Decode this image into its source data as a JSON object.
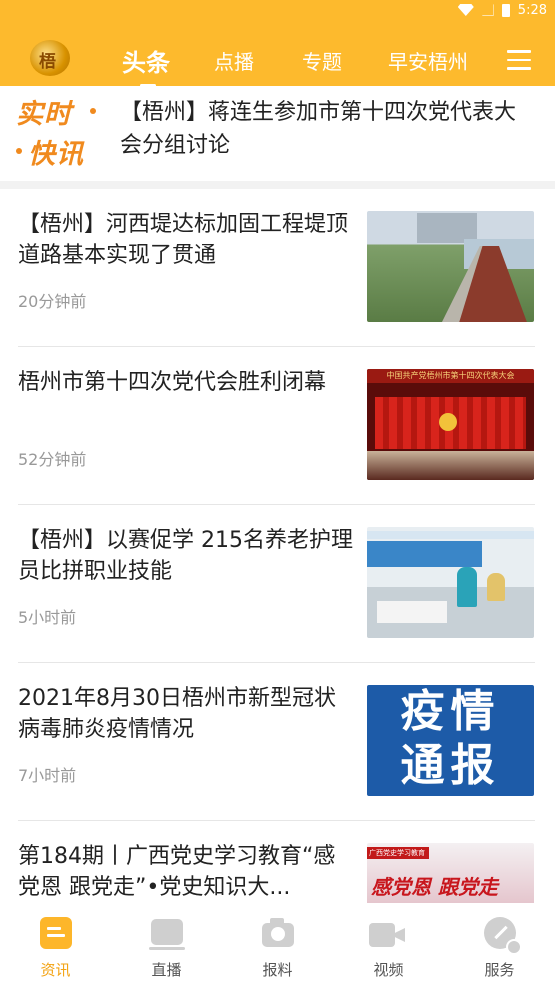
{
  "status_bar": {
    "time": "5:28"
  },
  "header": {
    "logo_text": "梧",
    "tabs": [
      {
        "label": "头条",
        "active": true
      },
      {
        "label": "点播",
        "active": false
      },
      {
        "label": "专题",
        "active": false
      },
      {
        "label": "早安梧州",
        "active": false
      }
    ]
  },
  "flash": {
    "badge_line1": "实时",
    "badge_line2": "快讯",
    "text": "【梧州】蒋连生参加市第十四次党代表大会分组讨论"
  },
  "news": [
    {
      "title": "【梧州】河西堤达标加固工程堤顶道路基本实现了贯通",
      "time": "20分钟前",
      "thumb": "road"
    },
    {
      "title": "梧州市第十四次党代会胜利闭幕",
      "time": "52分钟前",
      "thumb": "stage",
      "thumb_banner": "中国共产党梧州市第十四次代表大会"
    },
    {
      "title": "【梧州】以赛促学 215名养老护理员比拼职业技能",
      "time": "5小时前",
      "thumb": "training"
    },
    {
      "title": "2021年8月30日梧州市新型冠状病毒肺炎疫情情况",
      "time": "7小时前",
      "thumb": "epidemic",
      "thumb_line1": "疫情",
      "thumb_line2": "通报"
    },
    {
      "title": "第184期丨广西党史学习教育“感党恩 跟党走”•党史知识大...",
      "time": "",
      "thumb": "party",
      "thumb_tag": "广西党史学习教育",
      "thumb_text": "感党恩 跟党走"
    }
  ],
  "bottom_nav": [
    {
      "label": "资讯",
      "icon": "news-icon",
      "active": true
    },
    {
      "label": "直播",
      "icon": "live-tv-icon",
      "active": false
    },
    {
      "label": "报料",
      "icon": "camera-icon",
      "active": false
    },
    {
      "label": "视频",
      "icon": "video-camera-icon",
      "active": false
    },
    {
      "label": "服务",
      "icon": "service-compass-icon",
      "active": false
    }
  ],
  "colors": {
    "accent": "#FDBA2D",
    "nav_active": "#F3A313",
    "flash_orange": "#F08A1E",
    "epidemic_blue": "#1D5BA8"
  }
}
